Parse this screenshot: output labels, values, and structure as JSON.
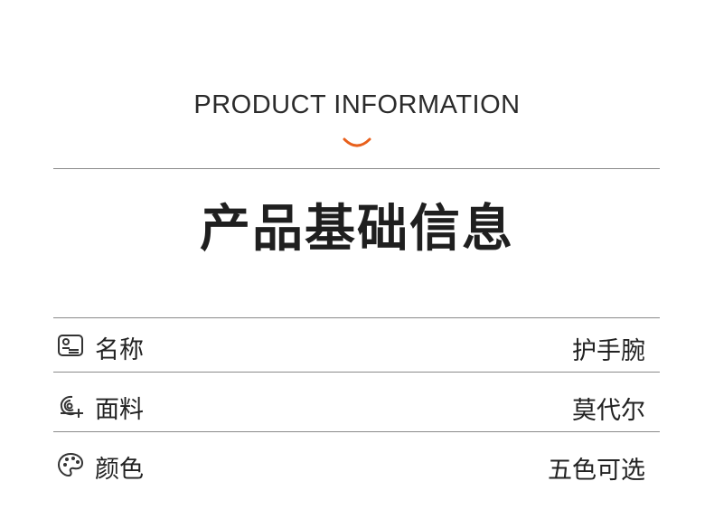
{
  "header": {
    "subtitle": "PRODUCT INFORMATION",
    "title": "产品基础信息",
    "accent_color": "#e8601c"
  },
  "rows": [
    {
      "icon": "id-card-icon",
      "label": "名称",
      "value": "护手腕"
    },
    {
      "icon": "fabric-roll-icon",
      "label": "面料",
      "value": "莫代尔"
    },
    {
      "icon": "palette-icon",
      "label": "颜色",
      "value": "五色可选"
    }
  ]
}
